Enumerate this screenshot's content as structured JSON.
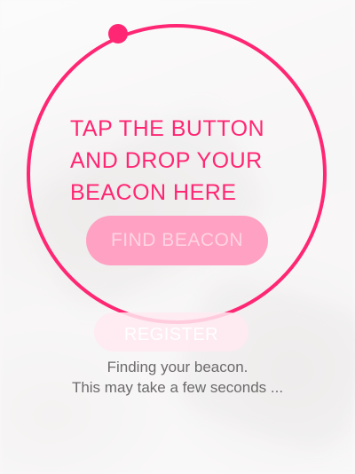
{
  "prompt": {
    "lines": [
      "TAP THE BUTTON",
      "AND DROP YOUR",
      "BEACON HERE"
    ]
  },
  "buttons": {
    "find_beacon": "FIND BEACON",
    "register": "REGISTER"
  },
  "status": {
    "line1": "Finding your beacon.",
    "line2": "This may take a few seconds ..."
  },
  "colors": {
    "accent": "#ff2673",
    "find_button_bg": "#ffa1c2",
    "status_text": "#6c6a6a"
  },
  "icons": {
    "progress_indicator": "ring-progress-dot"
  }
}
